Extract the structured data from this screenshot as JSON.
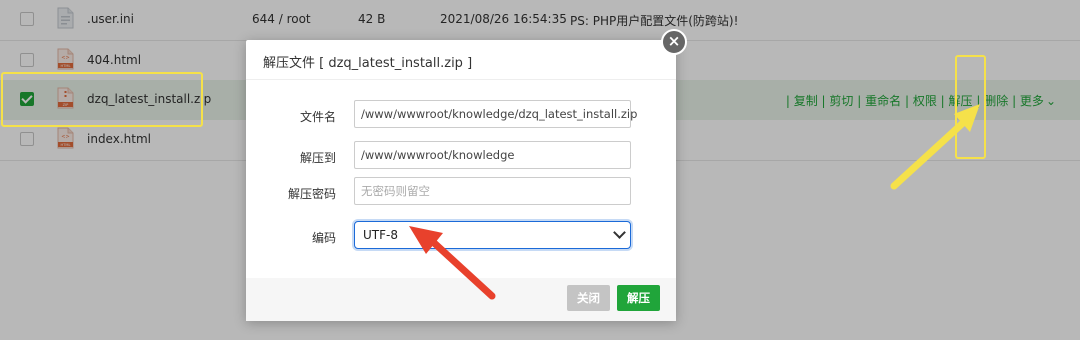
{
  "rows": [
    {
      "name": ".user.ini",
      "perm": "644 / root",
      "size": "42 B",
      "mtime": "2021/08/26 16:54:35",
      "note": "PS: PHP用户配置文件(防跨站)!",
      "icon": "ini-file-icon"
    },
    {
      "name": "404.html",
      "icon": "html-file-icon",
      "icon_text": "HTML"
    },
    {
      "name": "dzq_latest_install.zip",
      "icon": "zip-file-icon",
      "icon_text": "ZIP",
      "selected": true
    },
    {
      "name": "index.html",
      "icon": "html-file-icon",
      "icon_text": "HTML"
    }
  ],
  "ops": [
    "复制",
    "剪切",
    "重命名",
    "权限",
    "解压",
    "删除",
    "更多"
  ],
  "dialog": {
    "title": "解压文件 [ dzq_latest_install.zip ]",
    "close_symbol": "×",
    "fields": {
      "filename_label": "文件名",
      "filename_value": "/www/wwwroot/knowledge/dzq_latest_install.zip",
      "extract_to_label": "解压到",
      "extract_to_value": "/www/wwwroot/knowledge",
      "password_label": "解压密码",
      "password_placeholder": "无密码则留空",
      "encoding_label": "编码",
      "encoding_value": "UTF-8"
    },
    "buttons": {
      "cancel": "关闭",
      "extract": "解压"
    }
  },
  "colors": {
    "accent": "#20a53a",
    "highlight": "#f5e14a",
    "arrow": "#e8412c",
    "select_border": "#1b6ad8"
  }
}
